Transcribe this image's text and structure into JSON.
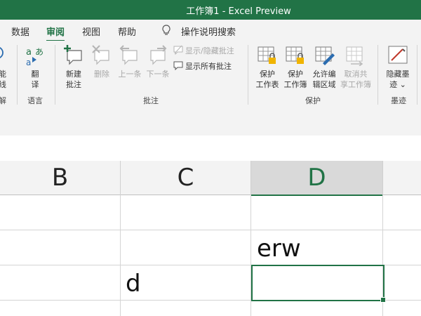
{
  "window": {
    "title": "工作簿1 - Excel Preview"
  },
  "menu": {
    "tabs": [
      {
        "label": "数据"
      },
      {
        "label": "审阅"
      },
      {
        "label": "视图"
      },
      {
        "label": "帮助"
      }
    ],
    "tell_me": "操作说明搜索"
  },
  "ribbon": {
    "cut_left": {
      "label_top": "能",
      "label_bottom": "线",
      "group": "解"
    },
    "translate": {
      "label_top": "翻",
      "label_bottom": "译"
    },
    "new_comment": {
      "label_top": "新建",
      "label_bottom": "批注"
    },
    "delete": {
      "label": "删除"
    },
    "previous": {
      "label": "上一条"
    },
    "next": {
      "label": "下一条"
    },
    "show_hide_comment": {
      "label": "显示/隐藏批注"
    },
    "show_all_comments": {
      "label": "显示所有批注"
    },
    "protect_sheet": {
      "label_top": "保护",
      "label_bottom": "工作表"
    },
    "protect_workbook": {
      "label_top": "保护",
      "label_bottom": "工作簿"
    },
    "allow_edit": {
      "label_top": "允许编",
      "label_bottom": "辑区域"
    },
    "unshare": {
      "label_top": "取消共",
      "label_bottom": "享工作簿"
    },
    "hide_ink": {
      "label_top": "隐藏墨",
      "label_bottom": "迹"
    },
    "groups": {
      "language": "语言",
      "comments": "批注",
      "protect": "保护",
      "ink": "墨迹"
    }
  },
  "sheet": {
    "columns": [
      "B",
      "C",
      "D"
    ],
    "cells": {
      "D_row2": "erw",
      "C_row3": "d"
    }
  },
  "colors": {
    "accent": "#217346"
  }
}
